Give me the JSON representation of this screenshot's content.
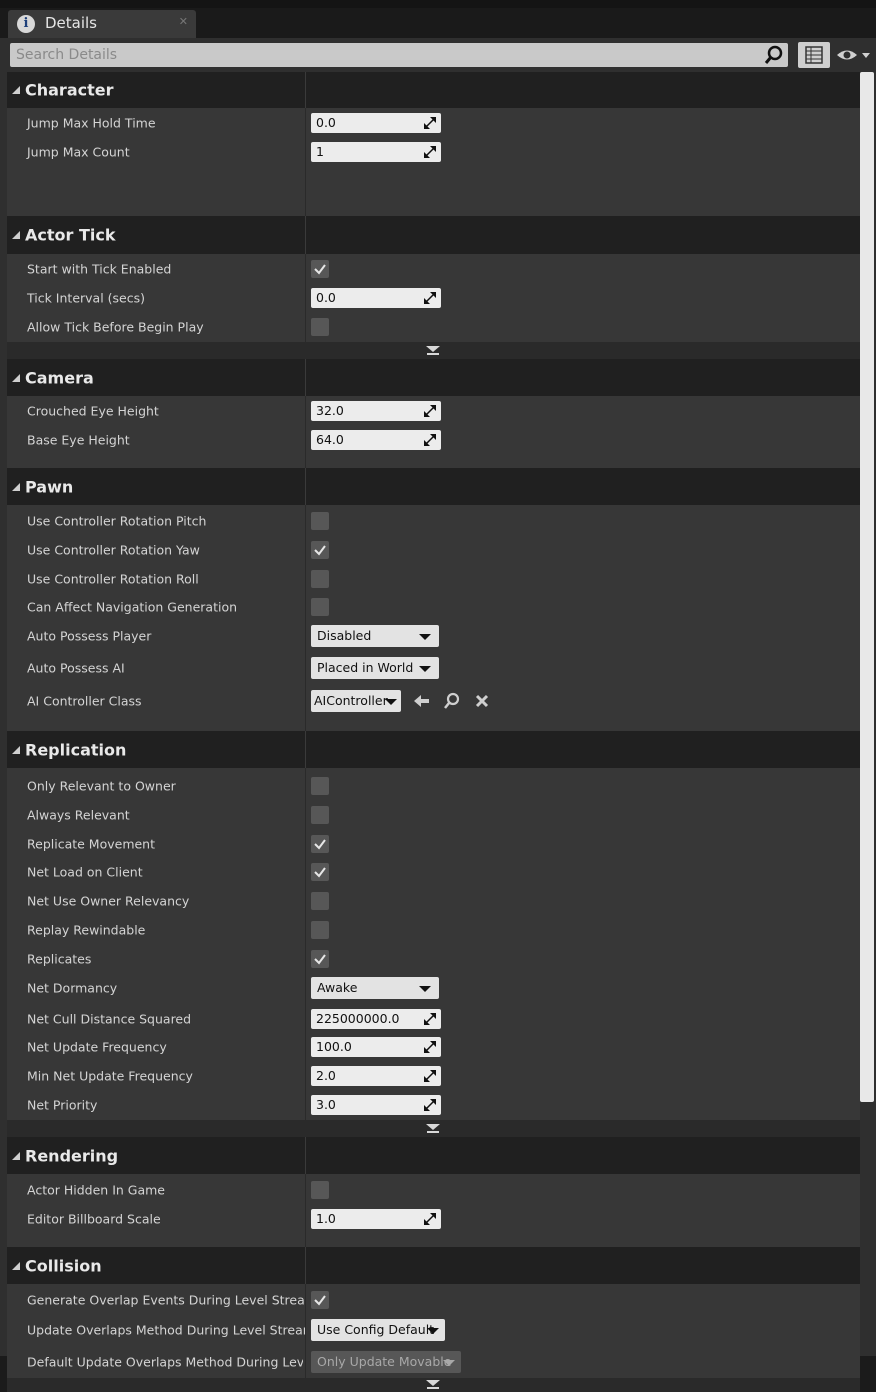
{
  "tab": {
    "title": "Details",
    "icon": "info-icon"
  },
  "search": {
    "placeholder": "Search Details"
  },
  "categories": {
    "character": {
      "label": "Character",
      "jump_max_hold_time": {
        "label": "Jump Max Hold Time",
        "value": "0.0"
      },
      "jump_max_count": {
        "label": "Jump Max Count",
        "value": "1"
      }
    },
    "actor_tick": {
      "label": "Actor Tick",
      "start_with_tick_enabled": {
        "label": "Start with Tick Enabled",
        "checked": true
      },
      "tick_interval": {
        "label": "Tick Interval (secs)",
        "value": "0.0"
      },
      "allow_tick_before_begin_play": {
        "label": "Allow Tick Before Begin Play",
        "checked": false
      }
    },
    "camera": {
      "label": "Camera",
      "crouched_eye_height": {
        "label": "Crouched Eye Height",
        "value": "32.0"
      },
      "base_eye_height": {
        "label": "Base Eye Height",
        "value": "64.0"
      }
    },
    "pawn": {
      "label": "Pawn",
      "use_controller_rotation_pitch": {
        "label": "Use Controller Rotation Pitch",
        "checked": false
      },
      "use_controller_rotation_yaw": {
        "label": "Use Controller Rotation Yaw",
        "checked": true
      },
      "use_controller_rotation_roll": {
        "label": "Use Controller Rotation Roll",
        "checked": false
      },
      "can_affect_navigation_generation": {
        "label": "Can Affect Navigation Generation",
        "checked": false
      },
      "auto_possess_player": {
        "label": "Auto Possess Player",
        "value": "Disabled"
      },
      "auto_possess_ai": {
        "label": "Auto Possess AI",
        "value": "Placed in World"
      },
      "ai_controller_class": {
        "label": "AI Controller Class",
        "value": "AIController"
      }
    },
    "replication": {
      "label": "Replication",
      "only_relevant_to_owner": {
        "label": "Only Relevant to Owner",
        "checked": false
      },
      "always_relevant": {
        "label": "Always Relevant",
        "checked": false
      },
      "replicate_movement": {
        "label": "Replicate Movement",
        "checked": true
      },
      "net_load_on_client": {
        "label": "Net Load on Client",
        "checked": true
      },
      "net_use_owner_relevancy": {
        "label": "Net Use Owner Relevancy",
        "checked": false
      },
      "replay_rewindable": {
        "label": "Replay Rewindable",
        "checked": false
      },
      "replicates": {
        "label": "Replicates",
        "checked": true
      },
      "net_dormancy": {
        "label": "Net Dormancy",
        "value": "Awake"
      },
      "net_cull_distance_squared": {
        "label": "Net Cull Distance Squared",
        "value": "225000000.0"
      },
      "net_update_frequency": {
        "label": "Net Update Frequency",
        "value": "100.0"
      },
      "min_net_update_frequency": {
        "label": "Min Net Update Frequency",
        "value": "2.0"
      },
      "net_priority": {
        "label": "Net Priority",
        "value": "3.0"
      }
    },
    "rendering": {
      "label": "Rendering",
      "actor_hidden_in_game": {
        "label": "Actor Hidden In Game",
        "checked": false
      },
      "editor_billboard_scale": {
        "label": "Editor Billboard Scale",
        "value": "1.0"
      }
    },
    "collision": {
      "label": "Collision",
      "generate_overlap_events": {
        "label": "Generate Overlap Events During Level Streaming",
        "checked": true
      },
      "update_overlaps_method": {
        "label": "Update Overlaps Method During Level Streaming",
        "value": "Use Config Default"
      },
      "default_update_overlaps_method": {
        "label": "Default Update Overlaps Method During Level Streaming",
        "value": "Only Update Movable"
      }
    }
  }
}
